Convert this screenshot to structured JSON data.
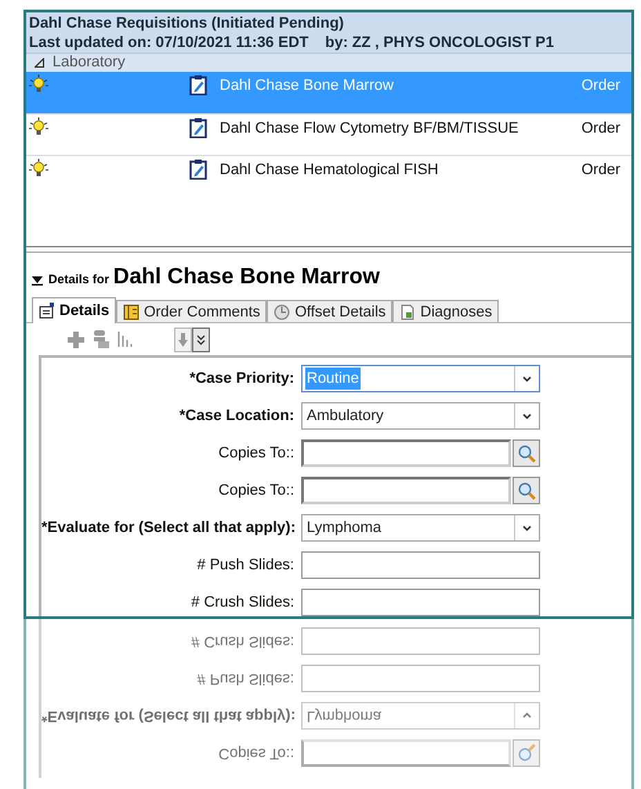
{
  "header": {
    "title": "Dahl Chase Requisitions (Initiated Pending)",
    "updated": "Last updated on: 07/10/2021 11:36 EDT",
    "by": "by: ZZ , PHYS ONCOLOGIST P1"
  },
  "group": {
    "label": "Laboratory",
    "expanded": true
  },
  "orders": [
    {
      "name": "Dahl Chase Bone Marrow",
      "type": "Order",
      "selected": true
    },
    {
      "name": "Dahl Chase Flow Cytometry BF/BM/TISSUE",
      "type": "Order",
      "selected": false
    },
    {
      "name": "Dahl Chase Hematological FISH",
      "type": "Order",
      "selected": false
    }
  ],
  "details": {
    "prefix": "Details for",
    "title": "Dahl Chase Bone Marrow",
    "expanded": true
  },
  "tabs": [
    {
      "label": "Details",
      "selected": true
    },
    {
      "label": "Order Comments",
      "selected": false
    },
    {
      "label": "Offset Details",
      "selected": false
    },
    {
      "label": "Diagnoses",
      "selected": false
    }
  ],
  "fields": [
    {
      "kind": "dropdown",
      "label": "*Case Priority:",
      "value": "Routine",
      "focused": true
    },
    {
      "kind": "dropdown",
      "label": "*Case Location:",
      "value": "Ambulatory",
      "focused": false
    },
    {
      "kind": "lookup",
      "label": "Copies To::"
    },
    {
      "kind": "lookup",
      "label": "Copies To::"
    },
    {
      "kind": "dropdown",
      "label": "*Evaluate for (Select all that apply):",
      "value": "Lymphoma",
      "focused": false
    },
    {
      "kind": "text",
      "label": "# Push Slides:"
    },
    {
      "kind": "text",
      "label": "# Crush Slides:"
    }
  ],
  "reflection": [
    {
      "kind": "text",
      "label": "# Crush Slides:"
    },
    {
      "kind": "text",
      "label": "# Push Slides:"
    },
    {
      "kind": "dropdown",
      "label": "*Evaluate for (Select all that apply):",
      "value": "Lymphoma"
    },
    {
      "kind": "lookup",
      "label": "Copies To::"
    }
  ]
}
